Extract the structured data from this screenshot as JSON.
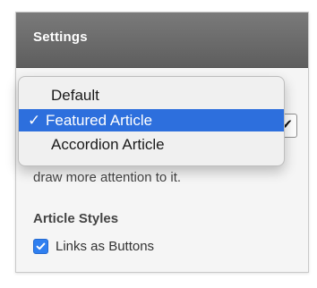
{
  "panel": {
    "title": "Settings"
  },
  "dropdown": {
    "options": [
      {
        "label": "Default",
        "selected": false
      },
      {
        "label": "Featured Article",
        "selected": true
      },
      {
        "label": "Accordion Article",
        "selected": false
      }
    ],
    "check_glyph": "✓"
  },
  "description": {
    "line_partial": "o",
    "line_2": "draw more attention to it."
  },
  "article_styles": {
    "heading": "Article Styles",
    "links_as_buttons": {
      "label": "Links as Buttons",
      "checked": true
    }
  },
  "colors": {
    "header": "#666666",
    "selection": "#2d6fdd",
    "checkbox": "#2f7ff0"
  }
}
